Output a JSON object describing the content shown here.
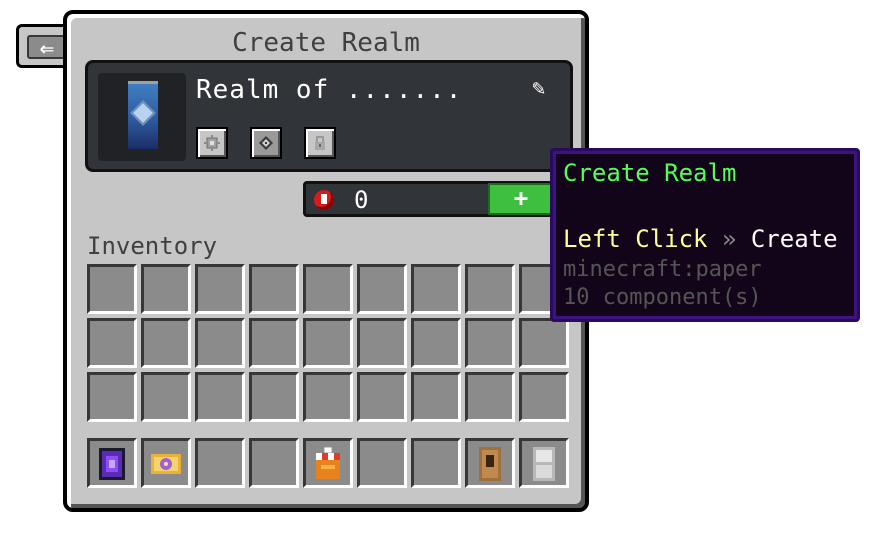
{
  "back_button": {
    "icon": "arrow-left-icon",
    "glyph": "⇐"
  },
  "window": {
    "title": "Create Realm"
  },
  "realm_card": {
    "name": "Realm of .......",
    "edit_icon": "pencil-icon",
    "edit_glyph": "✎",
    "banner_icon": "banner-icon",
    "options": [
      {
        "icon": "gear-icon"
      },
      {
        "icon": "globe-icon"
      },
      {
        "icon": "lock-icon"
      }
    ]
  },
  "currency": {
    "icon": "ruby-icon",
    "value": "0",
    "add_label": "+"
  },
  "inventory": {
    "label": "Inventory",
    "hotbar": [
      {
        "item": "portal-frame-icon"
      },
      {
        "item": "spawner-sign-icon"
      },
      {
        "item": ""
      },
      {
        "item": ""
      },
      {
        "item": "shop-stall-icon"
      },
      {
        "item": ""
      },
      {
        "item": ""
      },
      {
        "item": "wooden-door-icon"
      },
      {
        "item": "iron-door-icon"
      }
    ]
  },
  "tooltip": {
    "title": "Create Realm",
    "action_key": "Left Click",
    "separator": "»",
    "action": "Create",
    "item_id": "minecraft:paper",
    "components": "10 component(s)"
  },
  "colors": {
    "tooltip_title": "#55ff55",
    "tooltip_key": "#ffff9a",
    "add_button": "#3fbf3f",
    "currency": "#d21d1d"
  }
}
